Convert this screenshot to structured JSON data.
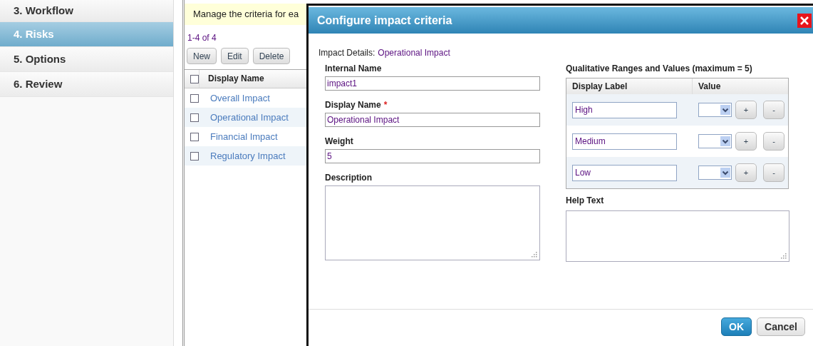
{
  "steps": [
    {
      "label": "3. Workflow",
      "selected": false
    },
    {
      "label": "4. Risks",
      "selected": true
    },
    {
      "label": "5. Options",
      "selected": false
    },
    {
      "label": "6. Review",
      "selected": false
    }
  ],
  "criteria_panel": {
    "banner": "Manage the criteria for ea",
    "count": "1-4 of 4",
    "buttons": [
      "New",
      "Edit",
      "Delete"
    ],
    "header": {
      "checked": false,
      "label": "Display Name"
    },
    "rows": [
      {
        "name": "Overall Impact",
        "checked": false
      },
      {
        "name": "Operational Impact",
        "checked": false
      },
      {
        "name": "Financial Impact",
        "checked": false
      },
      {
        "name": "Regulatory Impact",
        "checked": false
      }
    ]
  },
  "dialog": {
    "title": "Configure impact criteria",
    "details_label": "Impact Details:",
    "details_value": "Operational Impact",
    "fields": [
      {
        "kind": "input",
        "label": "Internal Name",
        "value": "impact1"
      },
      {
        "kind": "input",
        "label": "Display Name",
        "required_mark": "*",
        "value": "Operational Impact"
      },
      {
        "kind": "input",
        "label": "Weight",
        "value": "5"
      },
      {
        "kind": "textarea",
        "label": "Description"
      }
    ],
    "ranges": {
      "title": "Qualitative Ranges and Values (maximum = 5)",
      "columns": [
        "Display Label",
        "Value"
      ],
      "rows": [
        {
          "label": "High",
          "add": "+",
          "remove": "-"
        },
        {
          "label": "Medium",
          "add": "+",
          "remove": "-"
        },
        {
          "label": "Low",
          "add": "+",
          "remove": "-"
        }
      ]
    },
    "help_label": "Help Text",
    "buttons": [
      {
        "label": "OK",
        "kind": "primary"
      },
      {
        "label": "Cancel",
        "kind": "secondary"
      }
    ]
  }
}
